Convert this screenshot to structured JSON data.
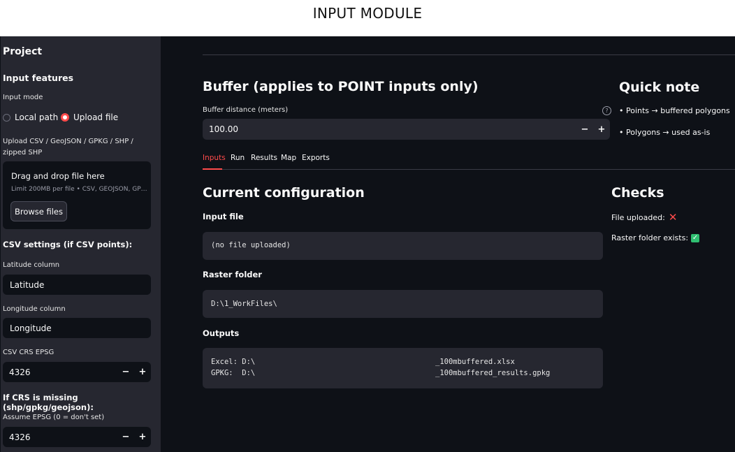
{
  "caption": "INPUT MODULE",
  "sidebar": {
    "project_heading": "Project",
    "input_features_heading": "Input features",
    "input_mode_label": "Input mode",
    "radio_local_path": "Local path",
    "radio_upload_file": "Upload file",
    "radio_selected": "Upload file",
    "upload_label": "Upload CSV / GeoJSON / GPKG / SHP / zipped SHP",
    "dropzone_title": "Drag and drop file here",
    "dropzone_limit": "Limit 200MB per file • CSV, GEOJSON, GP…",
    "browse_button": "Browse files",
    "csv_settings_heading": "CSV settings (if CSV points):",
    "latitude_label": "Latitude column",
    "latitude_value": "Latitude",
    "longitude_label": "Longitude column",
    "longitude_value": "Longitude",
    "csv_crs_label": "CSV CRS EPSG",
    "csv_crs_value": "4326",
    "crs_missing_heading": "If CRS is missing (shp/gpkg/geojson):",
    "assume_epsg_label": "Assume EPSG (0 = don't set)",
    "assume_epsg_value": "4326",
    "minus": "−",
    "plus": "+"
  },
  "main": {
    "buffer_heading": "Buffer (applies to POINT inputs only)",
    "buffer_label": "Buffer distance (meters)",
    "buffer_value": "100.00",
    "help_icon": "?",
    "quick_note_heading": "Quick note",
    "quick_note_items": [
      "• Points → buffered polygons",
      "• Polygons → used as-is"
    ],
    "tabs": [
      "Inputs",
      "Run",
      "Results",
      "Map",
      "Exports"
    ],
    "active_tab": "Inputs",
    "current_config_heading": "Current configuration",
    "input_file_label": "Input file",
    "input_file_value": "(no file uploaded)",
    "raster_folder_label": "Raster folder",
    "raster_folder_value": "D:\\1_WorkFiles\\",
    "outputs_label": "Outputs",
    "outputs_excel_prefix": "Excel: D:\\",
    "outputs_excel_suffix": "_100mbuffered.xlsx",
    "outputs_gpkg_prefix": "GPKG:  D:\\",
    "outputs_gpkg_suffix": "_100mbuffered_results.gpkg",
    "checks_heading": "Checks",
    "check_file_uploaded": "File uploaded:",
    "check_file_uploaded_status": "✕",
    "check_raster_exists": "Raster folder exists:",
    "check_raster_exists_status": "✓"
  },
  "colors": {
    "accent": "#ff4b4b",
    "sidebar_bg": "#262730",
    "main_bg": "#0e1117",
    "success": "#2fbf71"
  }
}
